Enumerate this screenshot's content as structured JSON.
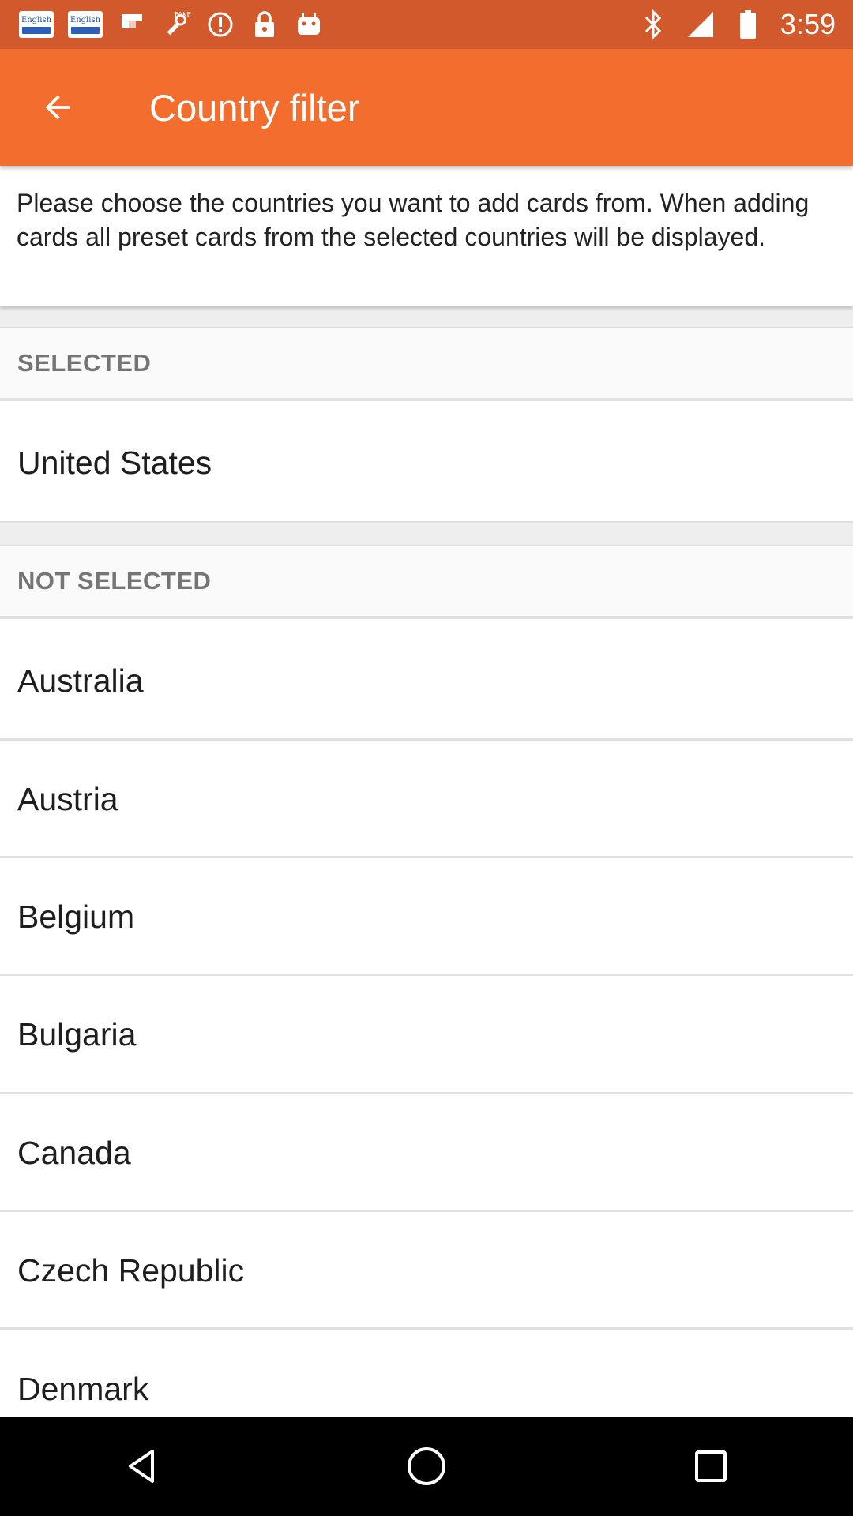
{
  "status_bar": {
    "time": "3:59",
    "notification_icons": [
      {
        "icon": "english-keyboard-icon",
        "label": "English"
      },
      {
        "icon": "english-keyboard-icon",
        "label": "English"
      },
      {
        "icon": "flipboard-icon"
      },
      {
        "icon": "fake-gps-icon"
      },
      {
        "icon": "alert-icon"
      },
      {
        "icon": "lock-icon"
      },
      {
        "icon": "android-icon"
      }
    ],
    "system_icons": [
      "bluetooth-icon",
      "signal-icon",
      "battery-icon"
    ]
  },
  "app_bar": {
    "title": "Country filter",
    "back_icon": "arrow-back-icon",
    "background": "#f26d2e"
  },
  "description": "Please choose the countries you want to add cards from. When adding cards all preset cards from the selected countries will be displayed.",
  "sections": {
    "selected": {
      "header": "SELECTED",
      "items": [
        "United States"
      ]
    },
    "not_selected": {
      "header": "NOT SELECTED",
      "items": [
        "Australia",
        "Austria",
        "Belgium",
        "Bulgaria",
        "Canada",
        "Czech Republic",
        "Denmark"
      ]
    }
  },
  "nav_bar": {
    "buttons": [
      "back-triangle-icon",
      "home-circle-icon",
      "recents-square-icon"
    ]
  }
}
